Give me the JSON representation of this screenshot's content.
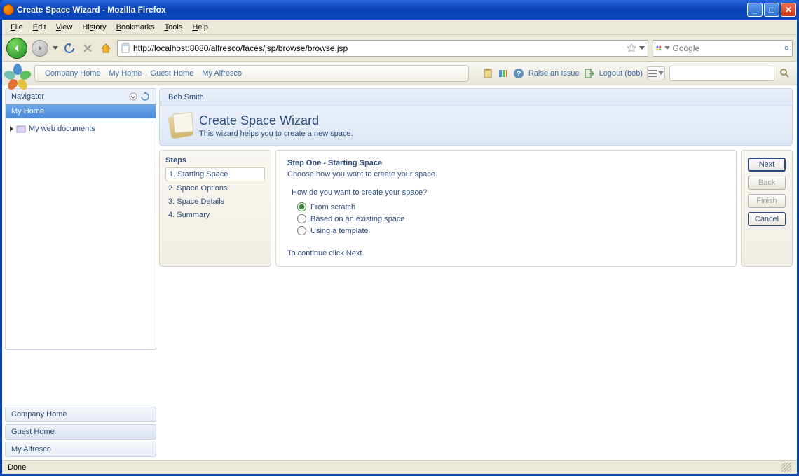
{
  "window": {
    "title": "Create Space Wizard - Mozilla Firefox"
  },
  "menubar": [
    "File",
    "Edit",
    "View",
    "History",
    "Bookmarks",
    "Tools",
    "Help"
  ],
  "toolbar": {
    "url": "http://localhost:8080/alfresco/faces/jsp/browse/browse.jsp",
    "search_placeholder": "Google"
  },
  "app_header": {
    "breadcrumb": [
      "Company Home",
      "My Home",
      "Guest Home",
      "My Alfresco"
    ],
    "raise_issue": "Raise an Issue",
    "logout": "Logout (bob)"
  },
  "sidebar": {
    "navigator": "Navigator",
    "selected": "My Home",
    "tree_item": "My web documents",
    "links": [
      "Company Home",
      "Guest Home",
      "My Alfresco"
    ]
  },
  "crumb_user": "Bob Smith",
  "wizard": {
    "title": "Create Space Wizard",
    "subtitle": "This wizard helps you to create a new space."
  },
  "steps": {
    "title": "Steps",
    "items": [
      "1. Starting Space",
      "2. Space Options",
      "3. Space Details",
      "4. Summary"
    ]
  },
  "form": {
    "title": "Step One - Starting Space",
    "subtitle": "Choose how you want to create your space.",
    "question": "How do you want to create your space?",
    "options": [
      "From scratch",
      "Based on an existing space",
      "Using a template"
    ],
    "footer": "To continue click Next."
  },
  "buttons": {
    "next": "Next",
    "back": "Back",
    "finish": "Finish",
    "cancel": "Cancel"
  },
  "statusbar": "Done"
}
